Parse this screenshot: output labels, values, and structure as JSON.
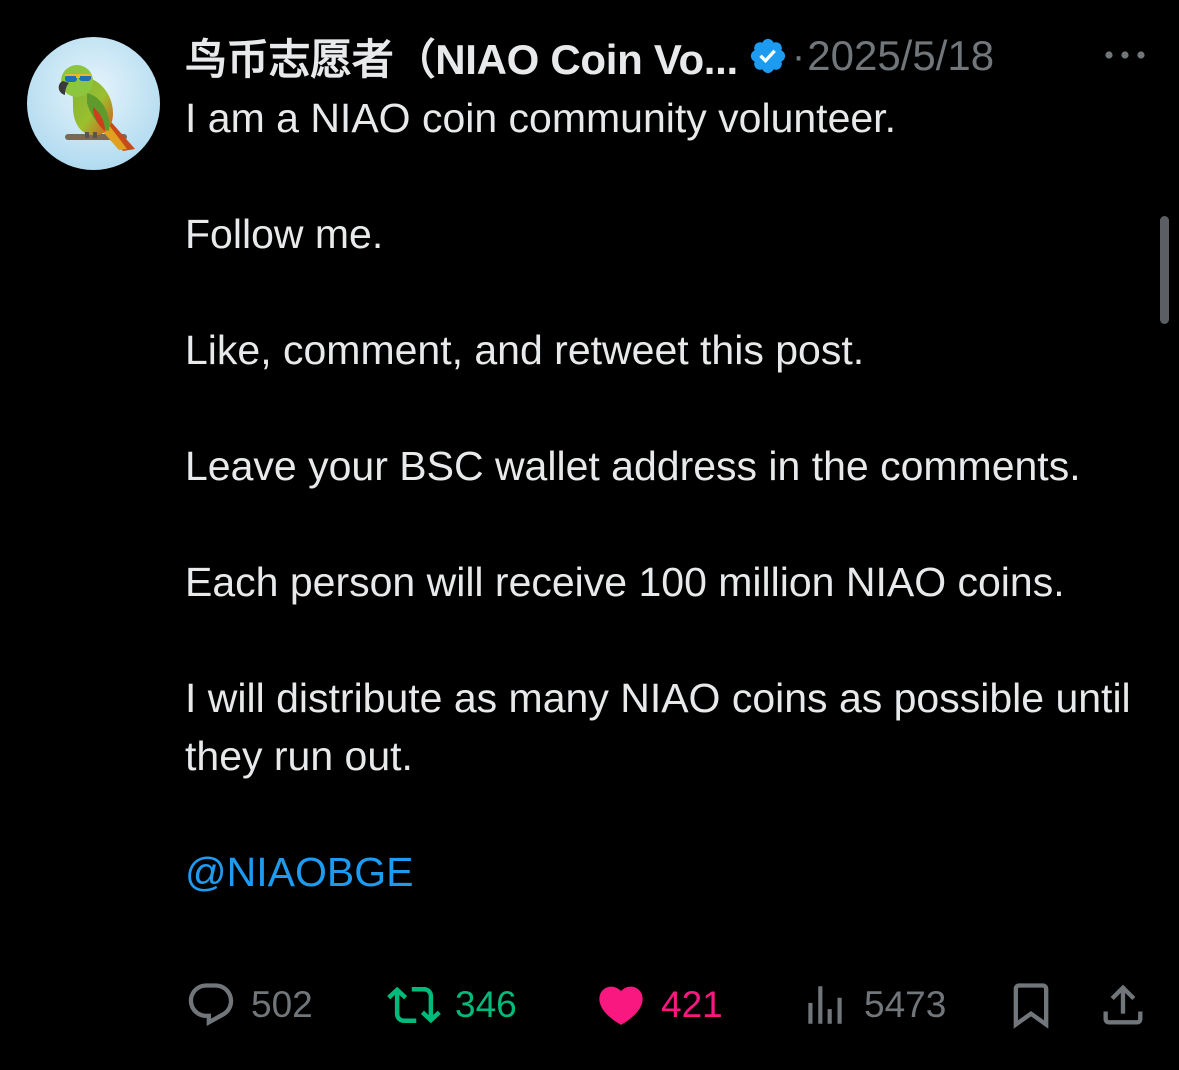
{
  "post": {
    "author": {
      "display_name": "鸟币志愿者（NIAO Coin Vo...",
      "verified": true,
      "avatar_icon": "parrot-with-sunglasses-avatar"
    },
    "separator": "·",
    "date": "2025/5/18",
    "more_icon": "ellipsis-icon",
    "paragraphs": [
      "I am a NIAO coin community volunteer.",
      "Follow me.",
      "Like, comment, and retweet this post.",
      "Leave your BSC wallet address in the comments.",
      "Each person will receive 100 million NIAO coins.",
      "I will distribute as many NIAO coins as possible until they run out."
    ],
    "mention": "@NIAOBGE",
    "actions": {
      "reply": {
        "icon": "reply-icon",
        "count": "502"
      },
      "retweet": {
        "icon": "retweet-icon",
        "count": "346"
      },
      "like": {
        "icon": "heart-icon",
        "count": "421"
      },
      "views": {
        "icon": "views-icon",
        "count": "5473"
      },
      "bookmark": {
        "icon": "bookmark-icon"
      },
      "share": {
        "icon": "share-icon"
      }
    }
  },
  "colors": {
    "background": "#000000",
    "text": "#e7e9ea",
    "muted": "#71767b",
    "link": "#1d9bf0",
    "retweet_active": "#00ba7c",
    "like_active": "#f91880"
  }
}
